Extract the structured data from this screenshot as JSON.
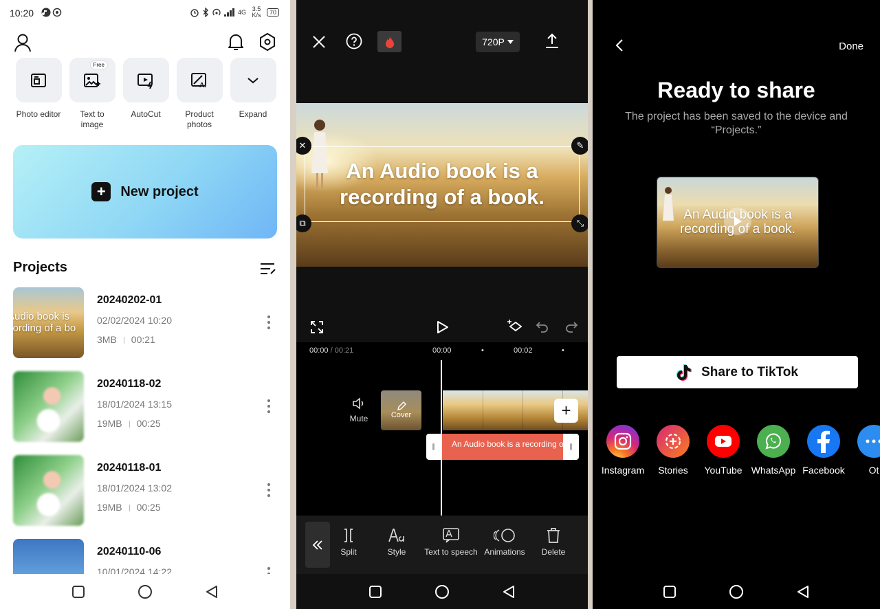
{
  "status": {
    "time": "10:20",
    "network": "4G",
    "speed": "3.5 K/s",
    "battery": "70"
  },
  "home": {
    "tools": [
      {
        "label": "Photo editor",
        "icon": "photo-editor-icon"
      },
      {
        "label": "Text to image",
        "icon": "text-to-image-icon",
        "badge": "Free"
      },
      {
        "label": "AutoCut",
        "icon": "autocut-icon"
      },
      {
        "label": "Product photos",
        "icon": "product-photos-icon"
      },
      {
        "label": "Expand",
        "icon": "chevron-down-icon"
      }
    ],
    "new_project": "New project",
    "projects_title": "Projects",
    "projects": [
      {
        "name": "20240202-01",
        "date": "02/02/2024 10:20",
        "size": "3MB",
        "duration": "00:21",
        "thumb_text": "Audio book is cording of a bo"
      },
      {
        "name": "20240118-02",
        "date": "18/01/2024 13:15",
        "size": "19MB",
        "duration": "00:25"
      },
      {
        "name": "20240118-01",
        "date": "18/01/2024 13:02",
        "size": "19MB",
        "duration": "00:25"
      },
      {
        "name": "20240110-06",
        "date": "10/01/2024 14:22"
      }
    ]
  },
  "editor": {
    "resolution": "720P",
    "caption": "An Audio book is a recording of a book.",
    "current_time": "00:00",
    "total_time": "00:21",
    "ruler": [
      "00:00",
      "00:02"
    ],
    "mute_label": "Mute",
    "cover_label": "Cover",
    "text_clip": "An Audio book is a  recording o",
    "toolbar": [
      {
        "label": "Split",
        "icon": "split-icon"
      },
      {
        "label": "Style",
        "icon": "style-icon"
      },
      {
        "label": "Text to speech",
        "icon": "text-to-speech-icon"
      },
      {
        "label": "Animations",
        "icon": "animations-icon"
      },
      {
        "label": "Delete",
        "icon": "delete-icon"
      }
    ]
  },
  "share": {
    "done": "Done",
    "title": "Ready to share",
    "subtitle": "The project has been saved to the device and “Projects.”",
    "preview_text": "An Audio book is a recording of a book.",
    "tiktok_button": "Share to TikTok",
    "targets": [
      {
        "label": "Instagram",
        "color": "#d62976"
      },
      {
        "label": "Stories",
        "color": "#e1306c"
      },
      {
        "label": "YouTube",
        "color": "#ff0000"
      },
      {
        "label": "WhatsApp",
        "color": "#4caf50"
      },
      {
        "label": "Facebook",
        "color": "#1877f2"
      },
      {
        "label": "Ot",
        "color": "#2d8cf0"
      }
    ]
  }
}
